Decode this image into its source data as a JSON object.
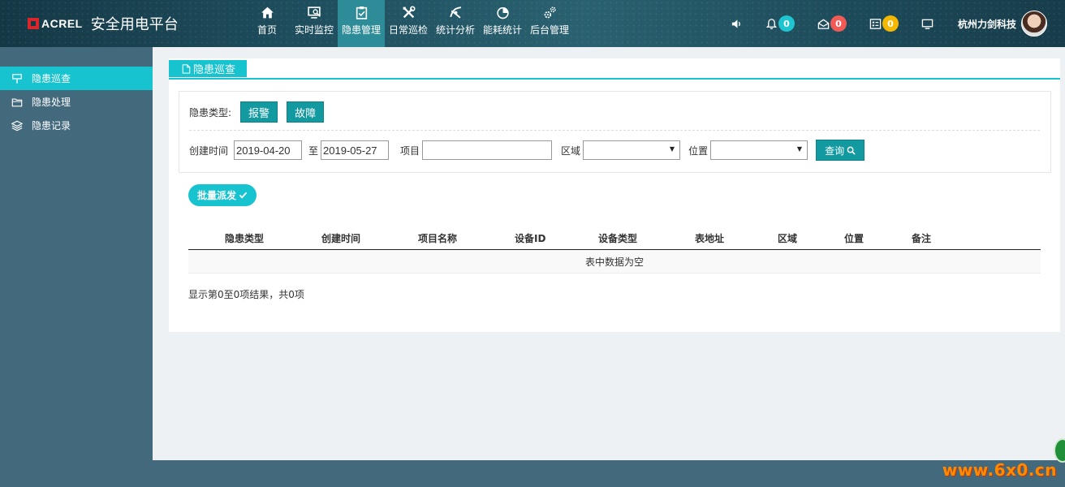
{
  "header": {
    "logo_text": "ACREL",
    "app_title": "安全用电平台",
    "nav": [
      {
        "label": "首页",
        "icon": "home-icon",
        "active": false
      },
      {
        "label": "实时监控",
        "icon": "monitor-icon",
        "active": false
      },
      {
        "label": "隐患管理",
        "icon": "clipboard-check-icon",
        "active": true
      },
      {
        "label": "日常巡检",
        "icon": "tools-icon",
        "active": false
      },
      {
        "label": "统计分析",
        "icon": "analysis-icon",
        "active": false
      },
      {
        "label": "能耗统计",
        "icon": "pie-chart-icon",
        "active": false
      },
      {
        "label": "后台管理",
        "icon": "gears-icon",
        "active": false
      }
    ],
    "badges": {
      "bell": "0",
      "mail": "0",
      "tasks": "0"
    },
    "user_name": "杭州力剑科技",
    "colors": {
      "badge_bell": "#1ec5d0",
      "badge_mail": "#f15a55",
      "badge_tasks": "#f5b800"
    }
  },
  "sidebar": {
    "items": [
      {
        "label": "隐患巡查",
        "icon": "hazard-inspect-icon",
        "active": true
      },
      {
        "label": "隐患处理",
        "icon": "folder-icon",
        "active": false
      },
      {
        "label": "隐患记录",
        "icon": "layers-icon",
        "active": false
      }
    ]
  },
  "panel": {
    "tab_label": "隐患巡查",
    "filter": {
      "type_label": "隐患类型:",
      "type_buttons": [
        "报警",
        "故障"
      ],
      "created_label": "创建时间",
      "date_from": "2019-04-20",
      "to_label": "至",
      "date_to": "2019-05-27",
      "project_label": "项目",
      "project_value": "",
      "area_label": "区域",
      "area_value": "",
      "location_label": "位置",
      "location_value": "",
      "query_label": "查询"
    },
    "batch_label": "批量派发",
    "table": {
      "columns": [
        "隐患类型",
        "创建时间",
        "项目名称",
        "设备ID",
        "设备类型",
        "表地址",
        "区域",
        "位置",
        "备注"
      ],
      "empty_text": "表中数据为空"
    },
    "info_text": "显示第0至0项结果，共0项"
  },
  "watermark": "www.6x0.cn",
  "accent_color": "#17c3cf",
  "button_color": "#139aa0"
}
